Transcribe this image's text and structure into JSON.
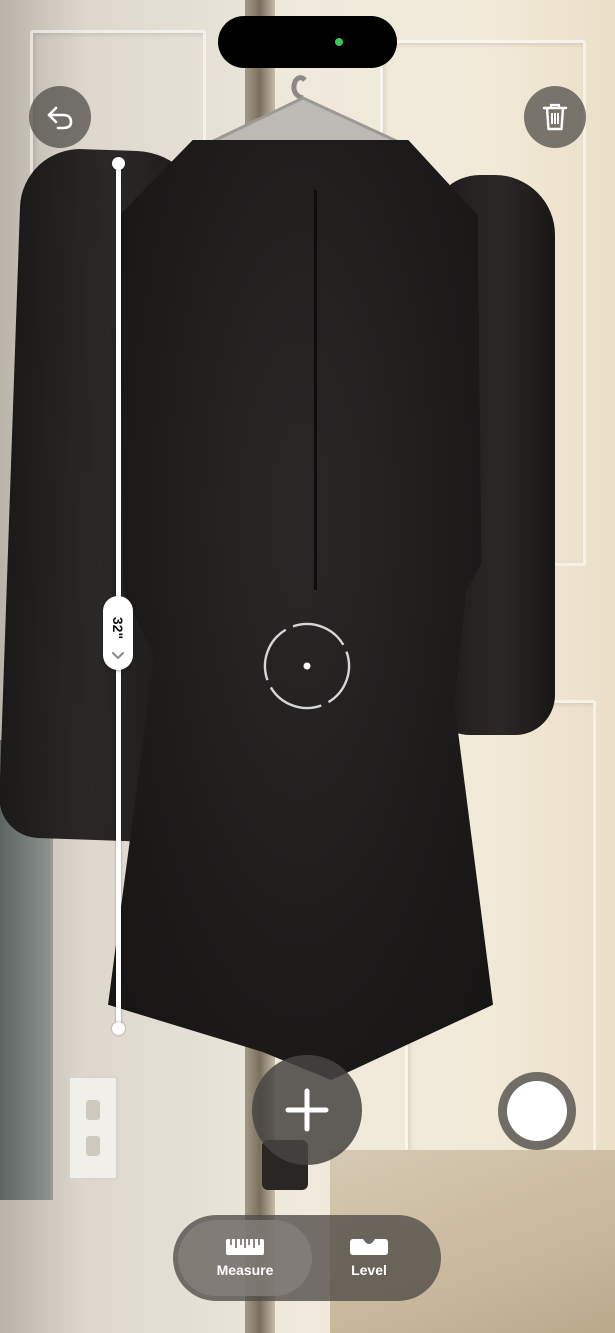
{
  "measurement": {
    "value_label": "32\""
  },
  "modes": [
    {
      "label": "Measure",
      "icon": "ruler-icon",
      "active": true
    },
    {
      "label": "Level",
      "icon": "level-icon",
      "active": false
    }
  ],
  "controls": {
    "undo_icon": "undo-arrow-icon",
    "delete_icon": "trash-icon",
    "add_icon": "plus-icon",
    "capture_icon": "shutter-icon"
  },
  "colors": {
    "measure_line": "#ffffff",
    "privacy_indicator": "#34c759"
  }
}
